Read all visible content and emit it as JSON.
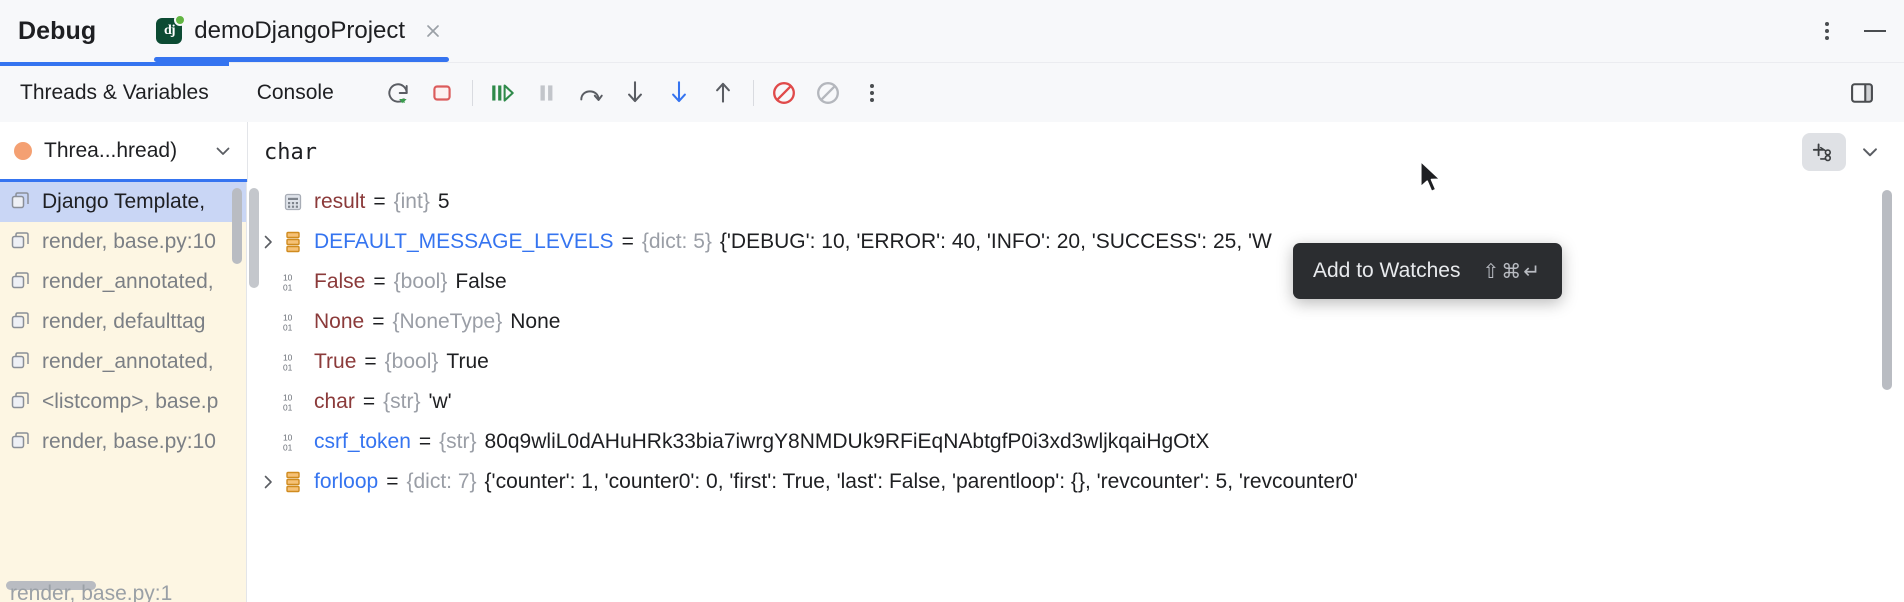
{
  "header": {
    "title": "Debug",
    "tab_label": "demoDjangoProject",
    "dj_icon_text": "dj",
    "close_label": "×",
    "accent_color": "#3574f0",
    "status_dot_color": "#62b543",
    "dj_bg_color": "#0c4b33"
  },
  "toolbar": {
    "tabs": [
      {
        "label": "Threads & Variables",
        "active": true
      },
      {
        "label": "Console",
        "active": false
      }
    ],
    "icons": [
      {
        "name": "rerun-icon"
      },
      {
        "name": "stop-icon"
      },
      {
        "name": "resume-icon"
      },
      {
        "name": "pause-icon"
      },
      {
        "name": "step-over-icon"
      },
      {
        "name": "step-into-icon"
      },
      {
        "name": "force-step-into-icon"
      },
      {
        "name": "step-out-icon"
      },
      {
        "name": "mute-breakpoints-icon"
      },
      {
        "name": "view-breakpoints-icon"
      },
      {
        "name": "more-options-icon"
      }
    ],
    "layout_icon": "layout-settings-icon"
  },
  "filter": {
    "thread_label": "Threa...hread)",
    "thread_dot_color": "#f4a072",
    "search_value": "char",
    "search_placeholder": "",
    "watch_button_label": "add-to-watches",
    "caret_label": "chevron-down"
  },
  "frames": [
    {
      "label": "Django Template,",
      "selected": true
    },
    {
      "label": "render, base.py:10",
      "selected": false
    },
    {
      "label": "render_annotated,",
      "selected": false
    },
    {
      "label": "render, defaulttag",
      "selected": false
    },
    {
      "label": "render_annotated,",
      "selected": false
    },
    {
      "label": "<listcomp>, base.p",
      "selected": false
    },
    {
      "label": "render, base.py:10",
      "selected": false
    }
  ],
  "frames_ghost": "render, base.py:1",
  "variables": [
    {
      "expandable": false,
      "icon": "int-icon",
      "name": "result",
      "name_color": "red",
      "type": "{int}",
      "value": "5"
    },
    {
      "expandable": true,
      "icon": "dict-icon",
      "name": "DEFAULT_MESSAGE_LEVELS",
      "name_color": "blue",
      "type": "{dict: 5}",
      "value": "{'DEBUG': 10, 'ERROR': 40, 'INFO': 20, 'SUCCESS': 25, 'W"
    },
    {
      "expandable": false,
      "icon": "bool-icon",
      "name": "False",
      "name_color": "red",
      "type": "{bool}",
      "value": "False"
    },
    {
      "expandable": false,
      "icon": "bool-icon",
      "name": "None",
      "name_color": "red",
      "type": "{NoneType}",
      "value": "None"
    },
    {
      "expandable": false,
      "icon": "bool-icon",
      "name": "True",
      "name_color": "red",
      "type": "{bool}",
      "value": "True"
    },
    {
      "expandable": false,
      "icon": "bool-icon",
      "name": "char",
      "name_color": "red",
      "type": "{str}",
      "value": "'w'"
    },
    {
      "expandable": false,
      "icon": "bool-icon",
      "name": "csrf_token",
      "name_color": "blue",
      "type": "{str}",
      "value": "80q9wliL0dAHuHRk33bia7iwrgY8NMDUk9RFiEqNAbtgfP0i3xd3wljkqaiHgOtX"
    },
    {
      "expandable": true,
      "icon": "dict-icon",
      "name": "forloop",
      "name_color": "blue",
      "type": "{dict: 7}",
      "value": "{'counter': 1, 'counter0': 0, 'first': True, 'last': False, 'parentloop': {}, 'revcounter': 5, 'revcounter0'"
    }
  ],
  "tooltip": {
    "text": "Add to Watches",
    "shortcut": "⇧⌘↵"
  }
}
